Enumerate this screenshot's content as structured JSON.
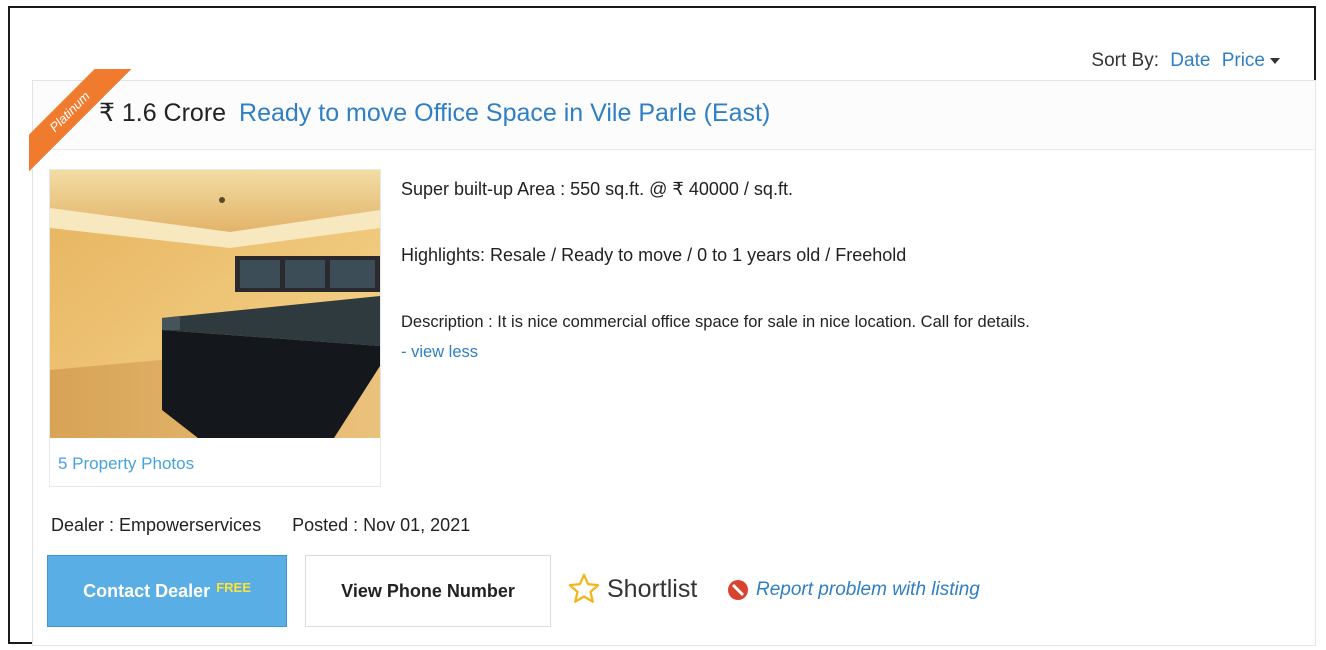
{
  "sort": {
    "label": "Sort By:",
    "options": [
      "Date",
      "Price"
    ]
  },
  "listing": {
    "badge": "Platinum",
    "price": "₹ 1.6 Crore",
    "headline": "Ready to move Office Space in Vile Parle (East)",
    "photos_link": "5 Property Photos",
    "area": "Super built-up Area : 550 sq.ft. @ ₹ 40000 / sq.ft.",
    "highlights": "Highlights: Resale / Ready to move / 0 to 1 years old / Freehold",
    "description_label": "Description :",
    "description": "It is nice commercial office space for sale in nice location. Call for details.",
    "view_less": "- view less",
    "dealer": "Dealer : Empowerservices",
    "posted": "Posted : Nov 01, 2021"
  },
  "actions": {
    "contact_label": "Contact Dealer",
    "contact_badge": "FREE",
    "phone_label": "View Phone Number",
    "shortlist_label": "Shortlist",
    "report_label": "Report problem with listing"
  },
  "icons": {
    "shortlist": "star-outline-icon",
    "report": "report-icon",
    "sort_caret": "caret-down-icon"
  },
  "colors": {
    "link": "#2f7fc5",
    "badge": "#f07a2e",
    "contact_button": "#5aaee6",
    "free_badge": "#ffe234",
    "report_icon": "#d9442f",
    "star": "#f2b51b"
  }
}
